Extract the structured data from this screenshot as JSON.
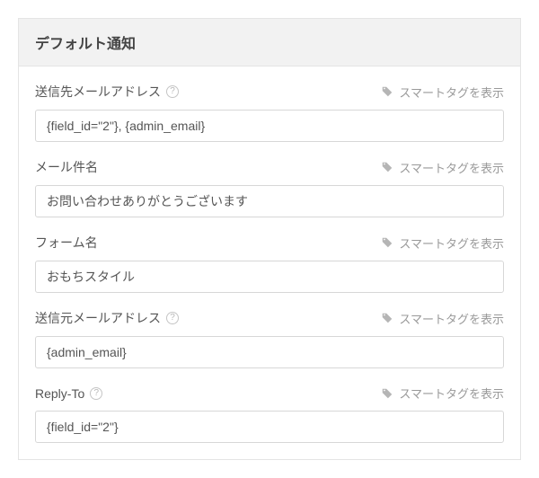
{
  "panel": {
    "title": "デフォルト通知"
  },
  "smart_tag_label": "スマートタグを表示",
  "fields": {
    "send_to": {
      "label": "送信先メールアドレス",
      "value": "{field_id=\"2\"}, {admin_email}",
      "has_help": true
    },
    "subject": {
      "label": "メール件名",
      "value": "お問い合わせありがとうございます",
      "has_help": false
    },
    "form_name": {
      "label": "フォーム名",
      "value": "おもちスタイル",
      "has_help": false
    },
    "from_address": {
      "label": "送信元メールアドレス",
      "value": "{admin_email}",
      "has_help": true
    },
    "reply_to": {
      "label": "Reply-To",
      "value": "{field_id=\"2\"}",
      "has_help": true
    }
  }
}
